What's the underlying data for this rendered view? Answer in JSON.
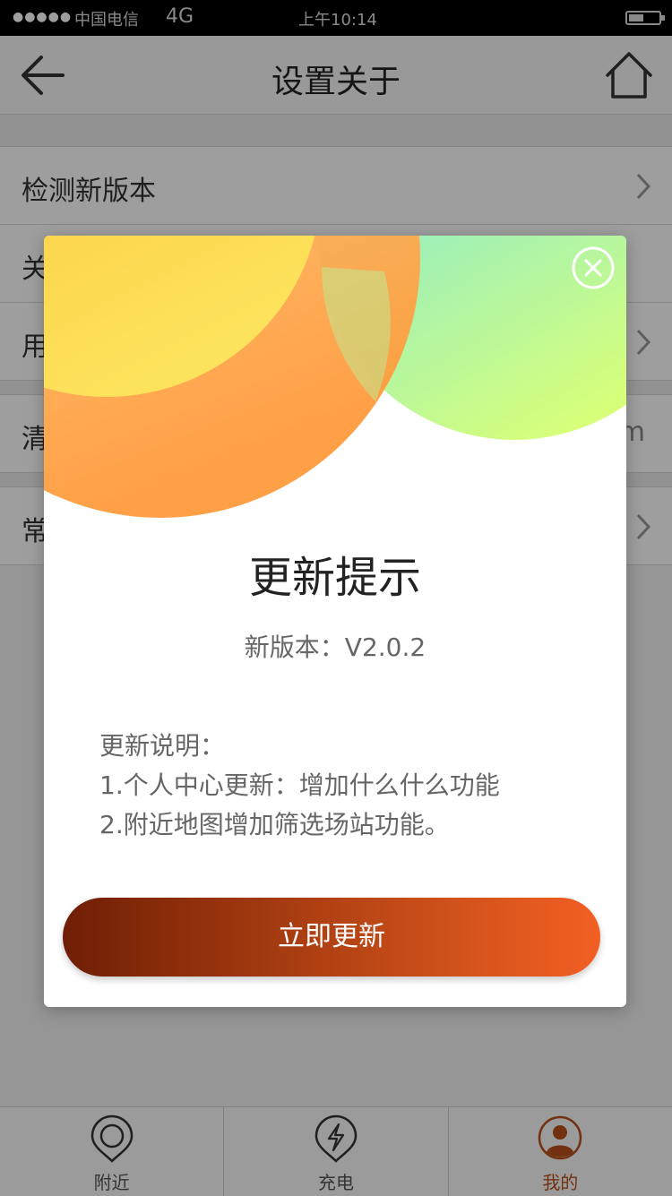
{
  "status_bar": {
    "signal": "●●●●●",
    "carrier": "中国电信",
    "network": "4G",
    "time": "上午10:14"
  },
  "header": {
    "title": "设置关于",
    "back_icon": "arrow-left-icon",
    "home_icon": "home-icon"
  },
  "settings_list": [
    {
      "label": "检测新版本",
      "chevron": true
    },
    {
      "label": "关",
      "chevron": false
    },
    {
      "label": "用",
      "chevron": true
    },
    {
      "label": "清",
      "extra": "m"
    },
    {
      "label": "常",
      "chevron": true
    }
  ],
  "dialog": {
    "title": "更新提示",
    "version": "新版本：V2.0.2",
    "notes_heading": "更新说明：",
    "notes": [
      "1.个人中心更新：增加什么什么功能",
      "2.附近地图增加筛选场站功能。"
    ],
    "button_label": "立即更新",
    "close_icon": "close-circle-icon",
    "colors": {
      "button_start": "#6f1e05",
      "button_end": "#f25f24"
    }
  },
  "tabbar": {
    "items": [
      {
        "label": "附近",
        "icon": "location-pin-icon",
        "active": false
      },
      {
        "label": "充电",
        "icon": "lightning-icon",
        "active": false
      },
      {
        "label": "我的",
        "icon": "user-icon",
        "active": true
      }
    ],
    "active_color": "#b8501b"
  }
}
